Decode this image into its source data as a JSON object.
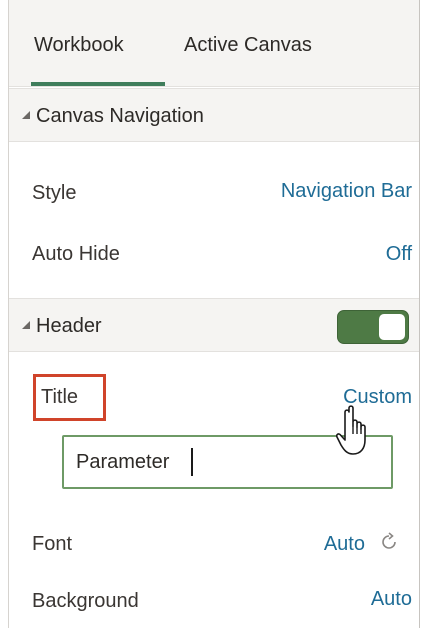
{
  "tabs": [
    {
      "label": "Workbook",
      "active": true
    },
    {
      "label": "Active Canvas",
      "active": false
    }
  ],
  "sections": {
    "canvas_navigation": {
      "title": "Canvas Navigation",
      "style_label": "Style",
      "style_value": "Navigation Bar",
      "auto_hide_label": "Auto Hide",
      "auto_hide_value": "Off"
    },
    "header": {
      "title": "Header",
      "toggle_on": true,
      "title_label": "Title",
      "title_value": "Custom",
      "title_input_value": "Parameter",
      "font_label": "Font",
      "font_value": "Auto",
      "background_label": "Background",
      "background_value": "Auto"
    }
  },
  "colors": {
    "accent_green": "#3f7d5b",
    "toggle_green": "#4e7a45",
    "link_blue": "#1f6c96",
    "highlight_red": "#d0442a"
  },
  "icons": [
    "caret-down-icon",
    "refresh-icon",
    "hand-pointer-icon"
  ]
}
